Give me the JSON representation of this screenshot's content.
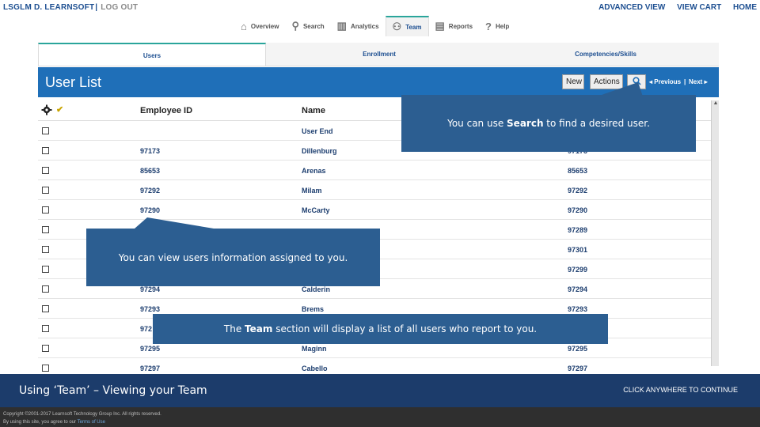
{
  "header": {
    "brand": "LSGLM D. LEARNSOFT",
    "separator": "|",
    "logout": "LOG OUT",
    "links": [
      "ADVANCED VIEW",
      "VIEW CART",
      "HOME"
    ]
  },
  "nav": {
    "items": [
      {
        "label": "Overview",
        "icon": "home-icon"
      },
      {
        "label": "Search",
        "icon": "search-icon"
      },
      {
        "label": "Analytics",
        "icon": "bar-chart-icon"
      },
      {
        "label": "Team",
        "icon": "team-icon",
        "active": true
      },
      {
        "label": "Reports",
        "icon": "document-icon"
      },
      {
        "label": "Help",
        "icon": "help-icon"
      }
    ]
  },
  "subtabs": [
    "Users",
    "Enrollment",
    "Competencies/Skills"
  ],
  "panel": {
    "title": "User List",
    "new_label": "New",
    "actions_label": "Actions",
    "prev_label": "◂ Previous",
    "next_label": "Next ▸",
    "pager_sep": "|"
  },
  "table": {
    "headers": [
      "Employee ID",
      "Name"
    ],
    "rows": [
      {
        "id": "",
        "name": "User End",
        "id2": ""
      },
      {
        "id": "97173",
        "name": "Dillenburg",
        "id2": "97173"
      },
      {
        "id": "85653",
        "name": "Arenas",
        "id2": "85653"
      },
      {
        "id": "97292",
        "name": "Milam",
        "id2": "97292"
      },
      {
        "id": "97290",
        "name": "McCarty",
        "id2": "97290"
      },
      {
        "id": "",
        "name": "",
        "id2": "97289"
      },
      {
        "id": "",
        "name": "",
        "id2": "97301"
      },
      {
        "id": "",
        "name": "",
        "id2": "97299"
      },
      {
        "id": "97294",
        "name": "Calderin",
        "id2": "97294"
      },
      {
        "id": "97293",
        "name": "Brems",
        "id2": "97293"
      },
      {
        "id": "972",
        "name": "",
        "id2": ""
      },
      {
        "id": "97295",
        "name": "Maginn",
        "id2": "97295"
      },
      {
        "id": "97297",
        "name": "Cabello",
        "id2": "97297"
      }
    ]
  },
  "callouts": {
    "search_pre": "You can use ",
    "search_bold": "Search",
    "search_post": " to find a desired user.",
    "info": "You can view users information assigned to you.",
    "team_pre": "The ",
    "team_bold": "Team",
    "team_post": " section will display a list of all users who report to you."
  },
  "banner": {
    "lesson": "Using ‘Team’ – Viewing your Team",
    "cta": "CLICK ANYWHERE TO CONTINUE"
  },
  "footer": {
    "copyright": "Copyright ©2001-2017 Learnsoft Technology Group Inc. All rights reserved.",
    "agree": "By using this site, you agree to our",
    "terms": "Terms of Use"
  },
  "colors": {
    "brand_blue": "#1d4f91",
    "title_bar": "#1f6fb8",
    "callout": "#2c5e91",
    "banner": "#1c3c6b",
    "accent_teal": "#2aa59b"
  }
}
